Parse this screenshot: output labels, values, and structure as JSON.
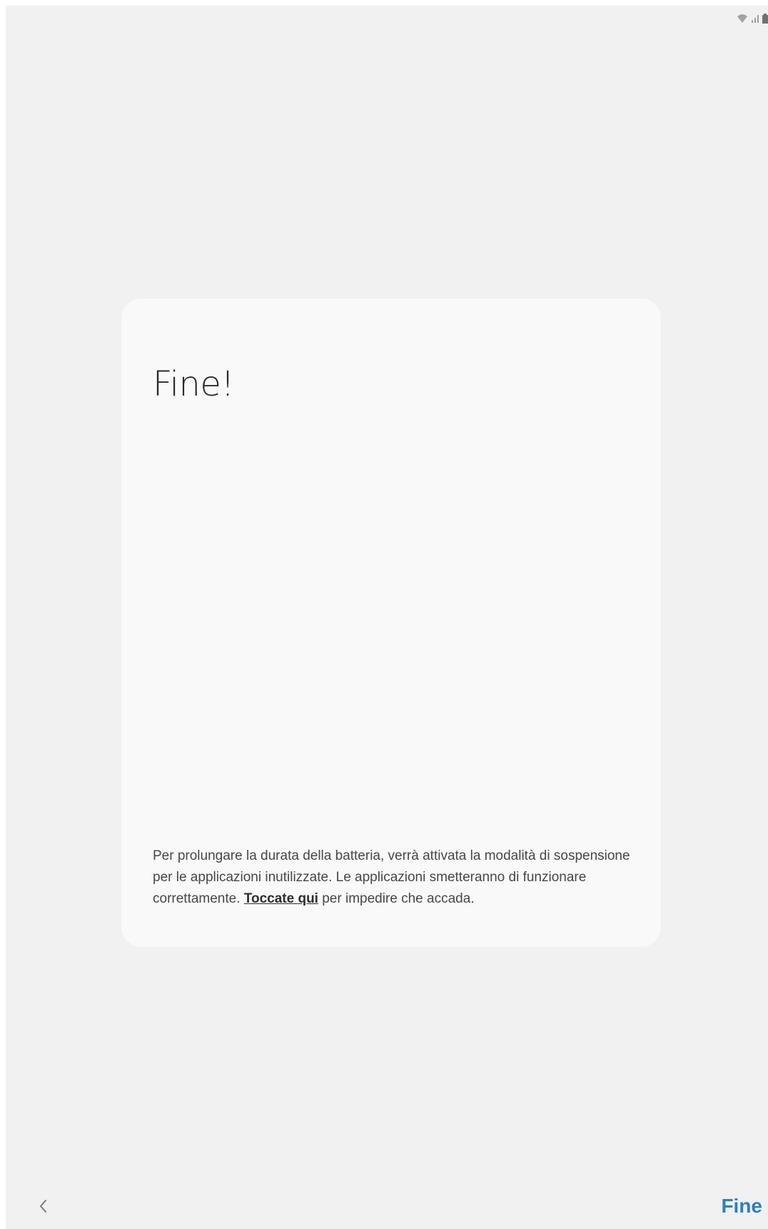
{
  "status_bar": {
    "icons": [
      "wifi-icon",
      "signal-icon",
      "battery-icon"
    ]
  },
  "card": {
    "title": "Fine!",
    "message_before_link": "Per prolungare la durata della batteria, verrà attivata la modalità di sospensione per le applicazioni inutilizzate. Le applicazioni smetteranno di funzionare correttamente. ",
    "link_text": "Toccate qui",
    "message_after_link": " per impedire che accada."
  },
  "navigation": {
    "back_icon": "chevron-left-icon",
    "done_label": "Fine"
  },
  "colors": {
    "background": "#f1f1f1",
    "card": "#f9f9f9",
    "accent": "#2d7fc4"
  }
}
